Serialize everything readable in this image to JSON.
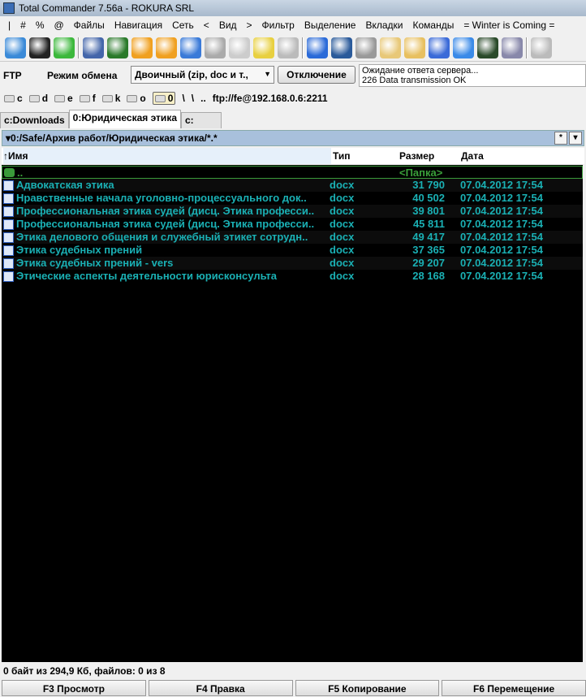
{
  "title": "Total Commander 7.56a - ROKURA SRL",
  "menu": [
    "|",
    "#",
    "%",
    "@",
    "Файлы",
    "Навигация",
    "Сеть",
    "<",
    "Вид",
    ">",
    "Фильтр",
    "Выделение",
    "Вкладки",
    "Команды",
    "= Winter is Coming ="
  ],
  "toolbar_colors": [
    [
      "#3a8ad8",
      "#222",
      "#3cb83c"
    ],
    [
      "#4466aa",
      "#2a7a2a",
      "#f0a020",
      "#f0a020",
      "#3a7ad8",
      "#aaa",
      "#ccc",
      "#e8d040",
      "#bbb"
    ],
    [
      "#2a6ad8",
      "#2a5a9a",
      "#999",
      "#e8c878",
      "#e8c060",
      "#3a6ad8",
      "#3a8ae8",
      "#2a4a2a",
      "#88a"
    ],
    [
      "#bbb"
    ]
  ],
  "ftp": {
    "label": "FTP",
    "mode_label": "Режим обмена",
    "mode_value": "Двоичный (zip, doc и т.,",
    "disconnect": "Отключение",
    "log": [
      "Ожидание ответа сервера...",
      "226 Data transmission OK"
    ]
  },
  "drives": [
    "c",
    "d",
    "e",
    "f",
    "k",
    "o",
    "0"
  ],
  "drive_extras": [
    "\\",
    "\\",
    "..",
    "ftp://fe@192.168.0.6:2211"
  ],
  "tabs": [
    "c:Downloads",
    "0:Юридическая этика",
    "c:"
  ],
  "path": "▾0:/Safe/Архив работ/Юридическая этика/*.*",
  "path_buttons": [
    "*",
    "▾"
  ],
  "columns": {
    "name": "↑Имя",
    "type": "Тип",
    "size": "Размер",
    "date": "Дата"
  },
  "updir": {
    "name": "..",
    "size": "<Папка>"
  },
  "files": [
    {
      "name": "Адвокатская этика",
      "type": "docx",
      "size": "31 790",
      "date": "07.04.2012 17:54"
    },
    {
      "name": "Нравственные начала уголовно-процессуального док..",
      "type": "docx",
      "size": "40 502",
      "date": "07.04.2012 17:54"
    },
    {
      "name": "Профессиональная этика судей (дисц. Этика професси..",
      "type": "docx",
      "size": "39 801",
      "date": "07.04.2012 17:54"
    },
    {
      "name": "Профессиональная этика судей (дисц. Этика професси..",
      "type": "docx",
      "size": "45 811",
      "date": "07.04.2012 17:54"
    },
    {
      "name": "Этика делового общения и служебный этикет сотрудн..",
      "type": "docx",
      "size": "49 417",
      "date": "07.04.2012 17:54"
    },
    {
      "name": "Этика судебных прений",
      "type": "docx",
      "size": "37 365",
      "date": "07.04.2012 17:54"
    },
    {
      "name": "Этика судебных прений - vers",
      "type": "docx",
      "size": "29 207",
      "date": "07.04.2012 17:54"
    },
    {
      "name": "Этические аспекты деятельности юрисконсульта",
      "type": "docx",
      "size": "28 168",
      "date": "07.04.2012 17:54"
    }
  ],
  "status": "0 байт из 294,9 Кб, файлов: 0 из 8",
  "fkeys": [
    "F3 Просмотр",
    "F4 Правка",
    "F5 Копирование",
    "F6 Перемещение"
  ]
}
